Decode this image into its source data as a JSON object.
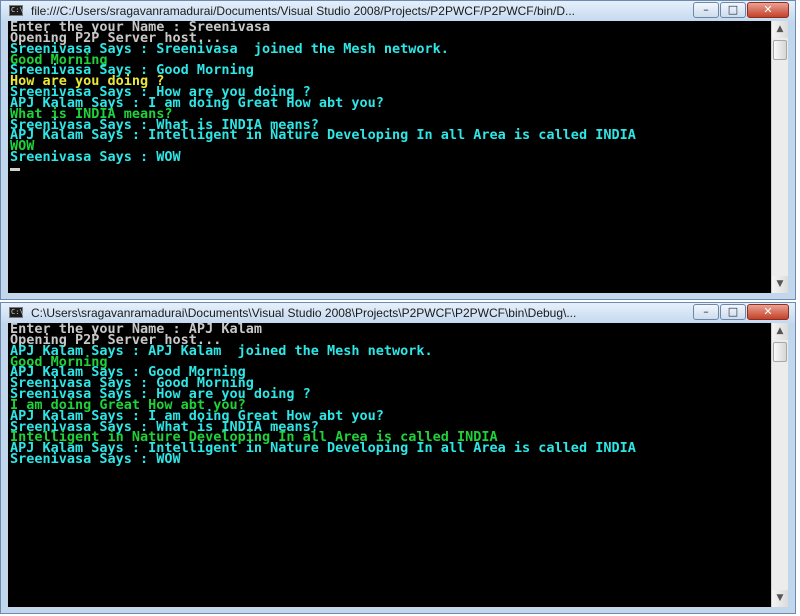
{
  "window1": {
    "title": "file:///C:/Users/sragavanramadurai/Documents/Visual Studio 2008/Projects/P2PWCF/P2PWCF/bin/D...",
    "controls": {
      "minimize": "–",
      "maximize": "□",
      "close": "✕"
    },
    "console_lines": [
      {
        "text": "Enter the your Name : Sreenivasa",
        "color": "white"
      },
      {
        "text": "Opening P2P Server host...",
        "color": "white"
      },
      {
        "text": "Sreenivasa Says : Sreenivasa  joined the Mesh network.",
        "color": "cyan"
      },
      {
        "text": "Good Morning",
        "color": "green"
      },
      {
        "text": "Sreenivasa Says : Good Morning",
        "color": "cyan"
      },
      {
        "text": "How are you doing ?",
        "color": "yellow"
      },
      {
        "text": "Sreenivasa Says : How are you doing ?",
        "color": "cyan"
      },
      {
        "text": "APJ Kalam Says : I am doing Great How abt you?",
        "color": "cyan"
      },
      {
        "text": "What is INDIA means?",
        "color": "green"
      },
      {
        "text": "Sreenivasa Says : What is INDIA means?",
        "color": "cyan"
      },
      {
        "text": "APJ Kalam Says : Intelligent in Nature Developing In all Area is called INDIA",
        "color": "cyan"
      },
      {
        "text": "WOW",
        "color": "green"
      },
      {
        "text": "Sreenivasa Says : WOW",
        "color": "cyan"
      }
    ]
  },
  "window2": {
    "title": "C:\\Users\\sragavanramadurai\\Documents\\Visual Studio 2008\\Projects\\P2PWCF\\P2PWCF\\bin\\Debug\\...",
    "controls": {
      "minimize": "–",
      "maximize": "□",
      "close": "✕"
    },
    "console_lines": [
      {
        "text": "Enter the your Name : APJ Kalam",
        "color": "white"
      },
      {
        "text": "Opening P2P Server host...",
        "color": "white"
      },
      {
        "text": "APJ Kalam Says : APJ Kalam  joined the Mesh network.",
        "color": "cyan"
      },
      {
        "text": "Good Morning",
        "color": "green"
      },
      {
        "text": "APJ Kalam Says : Good Morning",
        "color": "cyan"
      },
      {
        "text": "Sreenivasa Says : Good Morning",
        "color": "cyan"
      },
      {
        "text": "Sreenivasa Says : How are you doing ?",
        "color": "cyan"
      },
      {
        "text": "I am doing Great How abt you?",
        "color": "green"
      },
      {
        "text": "APJ Kalam Says : I am doing Great How abt you?",
        "color": "cyan"
      },
      {
        "text": "Sreenivasa Says : What is INDIA means?",
        "color": "cyan"
      },
      {
        "text": "Intelligent in Nature Developing In all Area is called INDIA",
        "color": "green"
      },
      {
        "text": "APJ Kalam Says : Intelligent in Nature Developing In all Area is called INDIA",
        "color": "cyan"
      },
      {
        "text": "Sreenivasa Says : WOW",
        "color": "cyan"
      }
    ]
  },
  "scrollbar": {
    "up_arrow": "▲",
    "down_arrow": "▼"
  },
  "colors": {
    "console_bg": "#000000",
    "white": "#c8c8c8",
    "cyan": "#2ee6e6",
    "green": "#1fd23a",
    "yellow": "#e8e83a",
    "titlebar": "#c5d9ef",
    "close_button": "#c4412a"
  }
}
